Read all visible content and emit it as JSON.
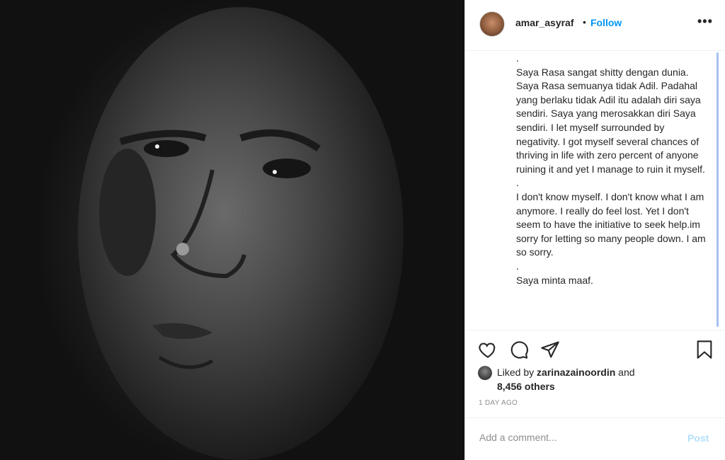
{
  "post": {
    "username": "amar_asyraf",
    "separator": "•",
    "follow_label": "Follow",
    "more_label": "•••",
    "caption_paragraphs": [
      ".",
      "Saya Rasa sangat shitty dengan dunia. Saya Rasa semuanya tidak Adil. Padahal yang berlaku tidak Adil itu adalah diri saya sendiri. Saya yang merosakkan diri Saya sendiri. I let myself surrounded by negativity. I got myself several chances of thriving in life with zero percent of anyone ruining it and yet I manage to ruin it myself.",
      ".",
      "I don't know myself. I don't know what I am anymore. I really do feel lost. Yet I don't seem to have the initiative to seek help.im sorry for letting so many people down. I am so sorry.",
      ".",
      "Saya minta maaf."
    ],
    "likes": {
      "prefix": "Liked by",
      "user": "zarinazainoordin",
      "and": "and",
      "count": "8,456 others"
    },
    "timestamp": "1 DAY AGO",
    "comment": {
      "placeholder": "Add a comment...",
      "post_label": "Post"
    },
    "icons": [
      "heart-icon",
      "comment-icon",
      "share-icon",
      "bookmark-icon"
    ]
  }
}
